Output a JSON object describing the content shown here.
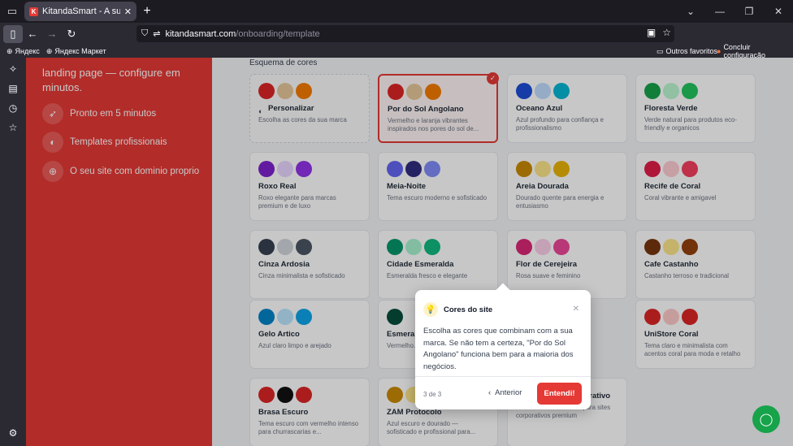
{
  "browser": {
    "tab": {
      "favicon": "K",
      "title": "KitandaSmart - A sua loja onlin",
      "close": "✕"
    },
    "url": {
      "host": "kitandasmart.com",
      "path": "/onboarding/template"
    },
    "bookmarks": {
      "b1": "Яндекс",
      "b2": "Яндекс Маркет",
      "r1": "Outros favoritos",
      "r2": "Concluir configuração"
    }
  },
  "left_panel": {
    "tagline": "landing page — configure em minutos.",
    "features": [
      {
        "icon": "rocket-icon",
        "label": "Pronto em 5 minutos"
      },
      {
        "icon": "palette-icon",
        "label": "Templates profissionais"
      },
      {
        "icon": "globe-icon",
        "label": "O seu site com dominio proprio"
      }
    ]
  },
  "content": {
    "section_title": "Esquema de cores",
    "cards": [
      {
        "name": "Personalizar",
        "desc": "Escolha as cores da sua marca",
        "colors": [
          "#dc2626",
          "#e7c79a",
          "#f57c00"
        ],
        "dashed": true
      },
      {
        "name": "Por do Sol Angolano",
        "desc": "Vermelho e laranja vibrantes inspirados nos pores do sol de...",
        "colors": [
          "#dc2626",
          "#e7c79a",
          "#f57c00"
        ],
        "selected": true
      },
      {
        "name": "Oceano Azul",
        "desc": "Azul profundo para confiança e profissionalismo",
        "colors": [
          "#1d4ed8",
          "#bfdbfe",
          "#06b6d4"
        ]
      },
      {
        "name": "Floresta Verde",
        "desc": "Verde natural para produtos eco-friendly e organicos",
        "colors": [
          "#16a34a",
          "#bbf7d0",
          "#22c55e"
        ]
      },
      {
        "name": "Roxo Real",
        "desc": "Roxo elegante para marcas premium e de luxo",
        "colors": [
          "#7e22ce",
          "#e9d5ff",
          "#9333ea"
        ]
      },
      {
        "name": "Meia-Noite",
        "desc": "Tema escuro moderno e sofisticado",
        "colors": [
          "#6366f1",
          "#312e81",
          "#818cf8"
        ]
      },
      {
        "name": "Areia Dourada",
        "desc": "Dourado quente para energia e entusiasmo",
        "colors": [
          "#ca8a04",
          "#fde68a",
          "#eab308"
        ]
      },
      {
        "name": "Recife de Coral",
        "desc": "Coral vibrante e amigavel",
        "colors": [
          "#e11d48",
          "#fecdd3",
          "#f43f5e"
        ]
      },
      {
        "name": "Cinza Ardosia",
        "desc": "Cinza minimalista e sofisticado",
        "colors": [
          "#374151",
          "#d1d5db",
          "#4b5563"
        ]
      },
      {
        "name": "Cidade Esmeralda",
        "desc": "Esmeralda fresco e elegante",
        "colors": [
          "#059669",
          "#a7f3d0",
          "#10b981"
        ]
      },
      {
        "name": "Flor de Cerejeira",
        "desc": "Rosa suave e feminino",
        "colors": [
          "#db2777",
          "#fbcfe8",
          "#ec4899"
        ]
      },
      {
        "name": "Cafe Castanho",
        "desc": "Castanho terroso e tradicional",
        "colors": [
          "#78350f",
          "#fde68a",
          "#92400e"
        ]
      },
      {
        "name": "Gelo Artico",
        "desc": "Azul claro limpo e arejado",
        "colors": [
          "#0284c7",
          "#bae6fd",
          "#0ea5e9"
        ]
      },
      {
        "name": "Esmeral",
        "desc": "Vermelho... neutros p...",
        "colors": [
          "#064e3b",
          "#ffffff",
          "#ffffff"
        ]
      },
      {
        "name": "",
        "desc": "",
        "colors": [],
        "blank": true
      },
      {
        "name": "UniStore Coral",
        "desc": "Tema claro e minimalista com acentos coral para moda e retalho",
        "colors": [
          "#dc2626",
          "#fecaca",
          "#dc2626"
        ]
      },
      {
        "name": "Brasa Escuro",
        "desc": "Tema escuro com vermelho intenso para churrascarias e...",
        "colors": [
          "#dc2626",
          "#111111",
          "#dc2626"
        ]
      },
      {
        "name": "ZAM Protocolo",
        "desc": "Azul escuro e dourado — sofisticado e profissional para...",
        "colors": [
          "#ca8a04",
          "#fde68a",
          "#0f172a"
        ]
      },
      {
        "name": "Azul Marinho Corporativo",
        "desc": "Azul marinho com ouro para sites corporativos premium",
        "colors": []
      }
    ]
  },
  "tooltip": {
    "title": "Cores do site",
    "body": "Escolha as cores que combinam com a sua marca. Se não tem a certeza, \"Por do Sol Angolano\" funciona bem para a maioria dos negócios.",
    "counter": "3 de 3",
    "prev": "Anterior",
    "next": "Entendi!"
  },
  "colors": {
    "accent": "#e53935",
    "chat": "#16a34a"
  }
}
